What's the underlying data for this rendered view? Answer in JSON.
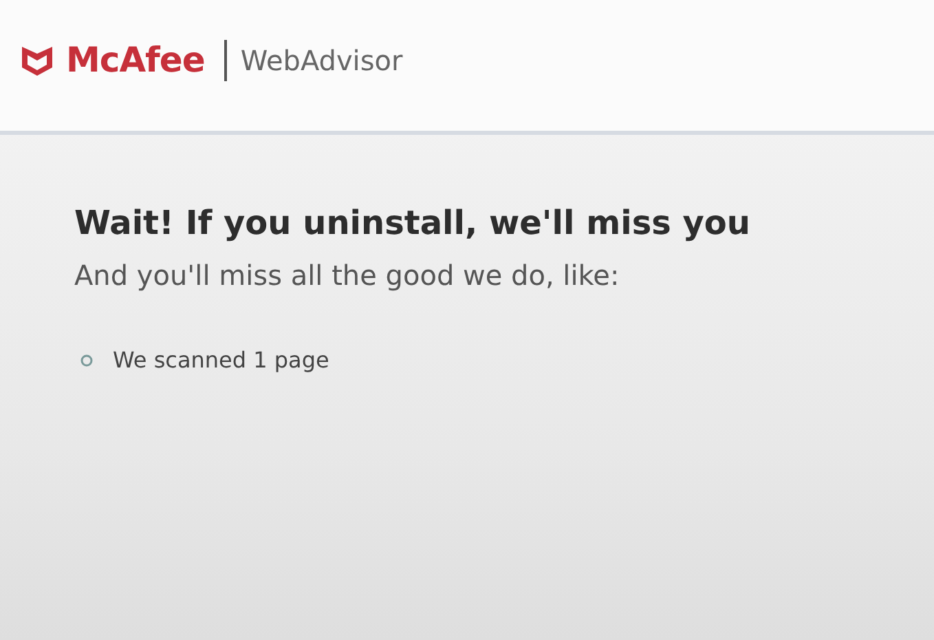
{
  "header": {
    "brand": "McAfee",
    "product": "WebAdvisor"
  },
  "heading": "Wait! If you uninstall, we'll miss you",
  "subheading": "And you'll miss all the good we do, like:",
  "benefits": [
    {
      "text": "We scanned 1 page"
    }
  ]
}
